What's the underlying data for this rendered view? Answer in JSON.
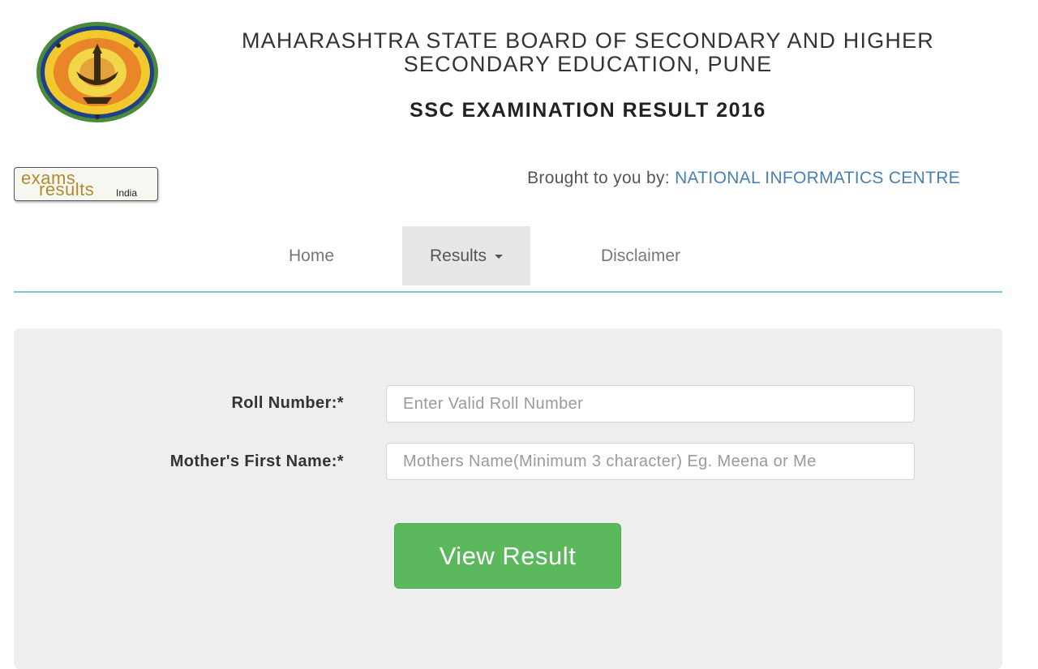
{
  "header": {
    "board_title": "MAHARASHTRA STATE BOARD OF SECONDARY AND HIGHER SECONDARY EDUCATION, PUNE",
    "exam_title": "SSC EXAMINATION RESULT 2016",
    "emblem_icon": "msbshse-emblem-icon"
  },
  "partner_logo": {
    "line1": "exams",
    "line2": "results",
    "line3": "India"
  },
  "credit": {
    "prefix": "Brought to you by:",
    "org": "NATIONAL INFORMATICS CENTRE",
    "org_color": "#4a7fb5"
  },
  "nav": {
    "items": [
      {
        "label": "Home",
        "active": false
      },
      {
        "label": "Results",
        "active": true,
        "has_dropdown": true
      },
      {
        "label": "Disclaimer",
        "active": false
      }
    ]
  },
  "form": {
    "roll_label": "Roll Number:*",
    "roll_placeholder": "Enter Valid Roll Number",
    "roll_value": "",
    "mother_label": "Mother's First Name:*",
    "mother_placeholder": "Mothers Name(Minimum 3 character) Eg. Meena or Me",
    "mother_value": "",
    "submit_label": "View Result"
  },
  "colors": {
    "accent": "#5cb85c",
    "nav_rule": "#7cc6dc",
    "panel_bg": "#eeeeee"
  }
}
